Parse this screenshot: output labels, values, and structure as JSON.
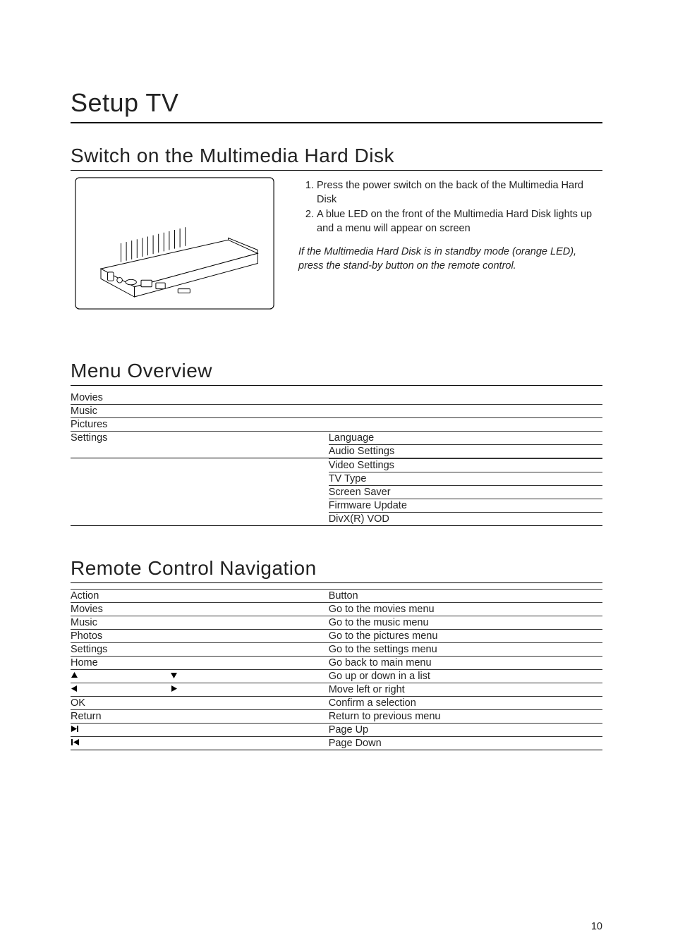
{
  "page_title": "Setup TV",
  "section1": {
    "heading": "Switch on the Multimedia Hard Disk",
    "step1": "Press the power switch on the back of the Multimedia Hard Disk",
    "step2": "A blue LED on the front of the Multimedia Hard Disk lights up and a menu will appear on screen",
    "note": "If the Multimedia Hard Disk is in standby mode (orange LED), press the stand-by button on the remote control."
  },
  "section2": {
    "heading": "Menu Overview",
    "rows": {
      "r0": "Movies",
      "r1": "Music",
      "r2": "Pictures",
      "r3": "Settings",
      "s0": "Language",
      "s1": "Audio Settings",
      "s2": "Video Settings",
      "s3": "TV Type",
      "s4": "Screen Saver",
      "s5": "Firmware Update",
      "s6": "DivX(R) VOD"
    }
  },
  "section3": {
    "heading": "Remote Control Navigation",
    "header_action": "Action",
    "header_button": "Button",
    "rows": {
      "a0": "Movies",
      "b0": "Go to the movies menu",
      "a1": "Music",
      "b1": "Go to the music menu",
      "a2": "Photos",
      "b2": "Go to the pictures menu",
      "a3": "Settings",
      "b3": "Go to the settings menu",
      "a4": "Home",
      "b4": "Go back to main menu",
      "b5": "Go up or down in a list",
      "b6": "Move left or right",
      "a7": "OK",
      "b7": "Confirm a selection",
      "a8": "Return",
      "b8": "Return to previous menu",
      "b9": "Page Up",
      "b10": "Page Down"
    }
  },
  "page_number": "10"
}
